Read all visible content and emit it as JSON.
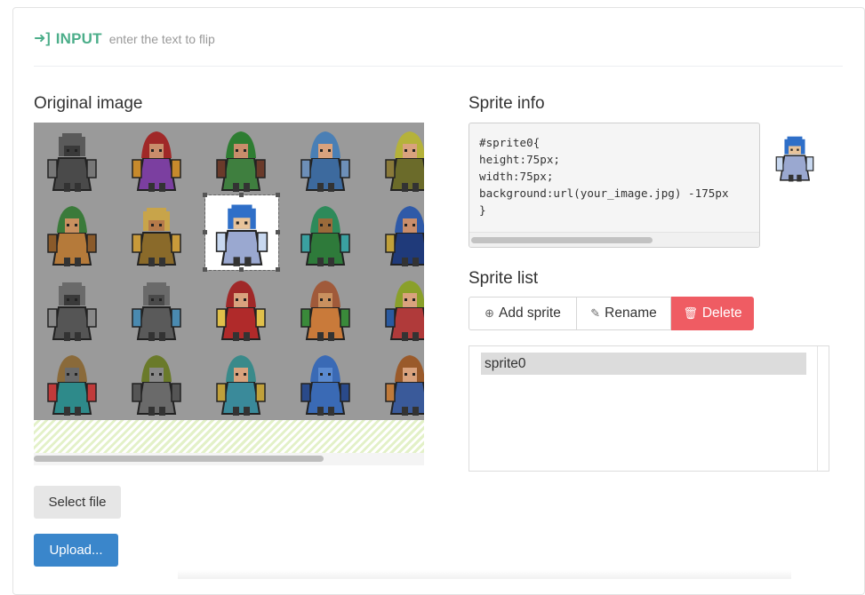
{
  "header": {
    "arrow_icon": "sign-in-icon",
    "title": "INPUT",
    "subtitle": "enter the text to flip",
    "accent_color": "#4cae8a"
  },
  "original": {
    "title": "Original image",
    "select_file_label": "Select file",
    "upload_label": "Upload..."
  },
  "sprite_info": {
    "title": "Sprite info",
    "code_lines": [
      "#sprite0{",
      "height:75px;",
      "width:75px;",
      "background:url(your_image.jpg) -175px",
      "}"
    ]
  },
  "sprite_list": {
    "title": "Sprite list",
    "add_label": "Add sprite",
    "rename_label": "Rename",
    "delete_label": "Delete",
    "delete_color": "#ef5c63",
    "items": [
      "sprite0"
    ]
  },
  "colors": {
    "upload_button": "#3a86cb",
    "sheet_background": "#9a9a9a"
  }
}
